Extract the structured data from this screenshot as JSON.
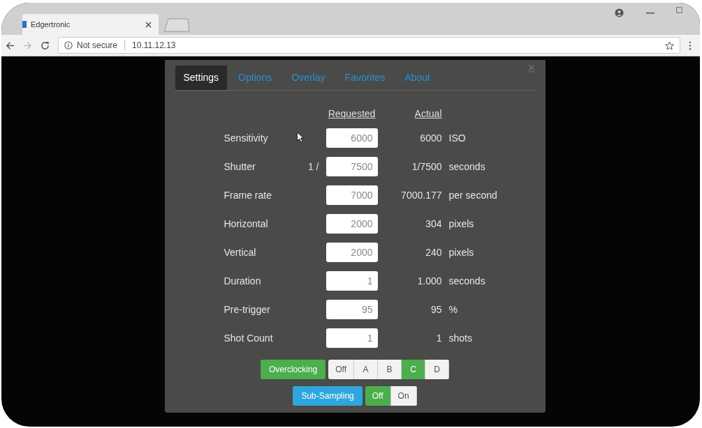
{
  "browser": {
    "tab_title": "Edgertronic",
    "security": "Not secure",
    "url": "10.11.12.13",
    "forward_disabled": true
  },
  "tabs": [
    {
      "label": "Settings",
      "selected": true
    },
    {
      "label": "Options",
      "selected": false
    },
    {
      "label": "Overlay",
      "selected": false
    },
    {
      "label": "Favorites",
      "selected": false
    },
    {
      "label": "About",
      "selected": false
    }
  ],
  "columns": [
    "Requested",
    "Actual"
  ],
  "rows": [
    {
      "label": "Sensitivity",
      "prefix": "",
      "requested": "6000",
      "actual": "6000",
      "unit": "ISO"
    },
    {
      "label": "Shutter",
      "prefix": "1 /",
      "requested": "7500",
      "actual": "1/7500",
      "unit": "seconds"
    },
    {
      "label": "Frame rate",
      "prefix": "",
      "requested": "7000",
      "actual": "7000.177",
      "unit": "per second"
    },
    {
      "label": "Horizontal",
      "prefix": "",
      "requested": "2000",
      "actual": "304",
      "unit": "pixels"
    },
    {
      "label": "Vertical",
      "prefix": "",
      "requested": "2000",
      "actual": "240",
      "unit": "pixels"
    },
    {
      "label": "Duration",
      "prefix": "",
      "requested": "1",
      "actual": "1.000",
      "unit": "seconds"
    },
    {
      "label": "Pre-trigger",
      "prefix": "",
      "requested": "95",
      "actual": "95",
      "unit": "%"
    },
    {
      "label": "Shot Count",
      "prefix": "",
      "requested": "1",
      "actual": "1",
      "unit": "shots"
    }
  ],
  "toggles": [
    {
      "label": "Overclocking",
      "color": "#4cae4c",
      "options": [
        {
          "label": "Off",
          "selected": false
        },
        {
          "label": "A",
          "selected": false
        },
        {
          "label": "B",
          "selected": false
        },
        {
          "label": "C",
          "selected": true
        },
        {
          "label": "D",
          "selected": false
        }
      ]
    },
    {
      "label": "Sub-Sampling",
      "color": "#2ea6dc",
      "options": [
        {
          "label": "Off",
          "selected": true
        },
        {
          "label": "On",
          "selected": false
        }
      ]
    }
  ]
}
